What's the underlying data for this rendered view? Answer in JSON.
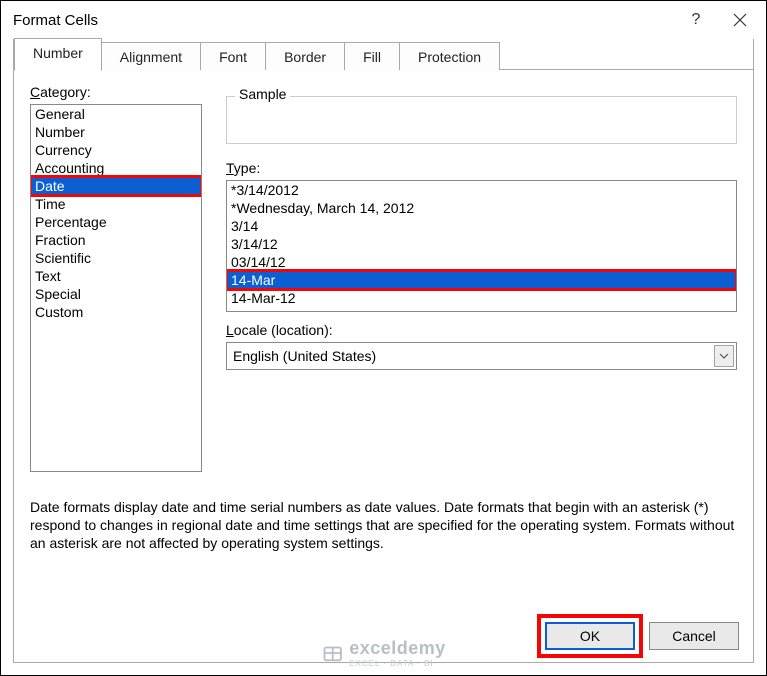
{
  "window": {
    "title": "Format Cells",
    "help_icon": "?",
    "close_icon": "×"
  },
  "tabs": [
    {
      "label": "Number",
      "active": true
    },
    {
      "label": "Alignment",
      "active": false
    },
    {
      "label": "Font",
      "active": false
    },
    {
      "label": "Border",
      "active": false
    },
    {
      "label": "Fill",
      "active": false
    },
    {
      "label": "Protection",
      "active": false
    }
  ],
  "category": {
    "label": "Category:",
    "underline_char": "C",
    "items": [
      {
        "label": "General",
        "selected": false
      },
      {
        "label": "Number",
        "selected": false
      },
      {
        "label": "Currency",
        "selected": false
      },
      {
        "label": "Accounting",
        "selected": false
      },
      {
        "label": "Date",
        "selected": true,
        "highlight": true
      },
      {
        "label": "Time",
        "selected": false
      },
      {
        "label": "Percentage",
        "selected": false
      },
      {
        "label": "Fraction",
        "selected": false
      },
      {
        "label": "Scientific",
        "selected": false
      },
      {
        "label": "Text",
        "selected": false
      },
      {
        "label": "Special",
        "selected": false
      },
      {
        "label": "Custom",
        "selected": false
      }
    ]
  },
  "sample": {
    "label": "Sample",
    "value": ""
  },
  "type": {
    "label": "Type:",
    "underline_char": "T",
    "items": [
      {
        "label": "*3/14/2012",
        "selected": false
      },
      {
        "label": "*Wednesday, March 14, 2012",
        "selected": false
      },
      {
        "label": "3/14",
        "selected": false
      },
      {
        "label": "3/14/12",
        "selected": false
      },
      {
        "label": "03/14/12",
        "selected": false
      },
      {
        "label": "14-Mar",
        "selected": true,
        "highlight": true
      },
      {
        "label": "14-Mar-12",
        "selected": false
      }
    ]
  },
  "locale": {
    "label": "Locale (location):",
    "underline_char": "L",
    "value": "English (United States)"
  },
  "description": "Date formats display date and time serial numbers as date values.  Date formats that begin with an asterisk (*) respond to changes in regional date and time settings that are specified for the operating system. Formats without an asterisk are not affected by operating system settings.",
  "buttons": {
    "ok": "OK",
    "cancel": "Cancel"
  },
  "watermark": {
    "brand": "exceldemy",
    "tagline": "EXCEL · DATA · BI"
  }
}
